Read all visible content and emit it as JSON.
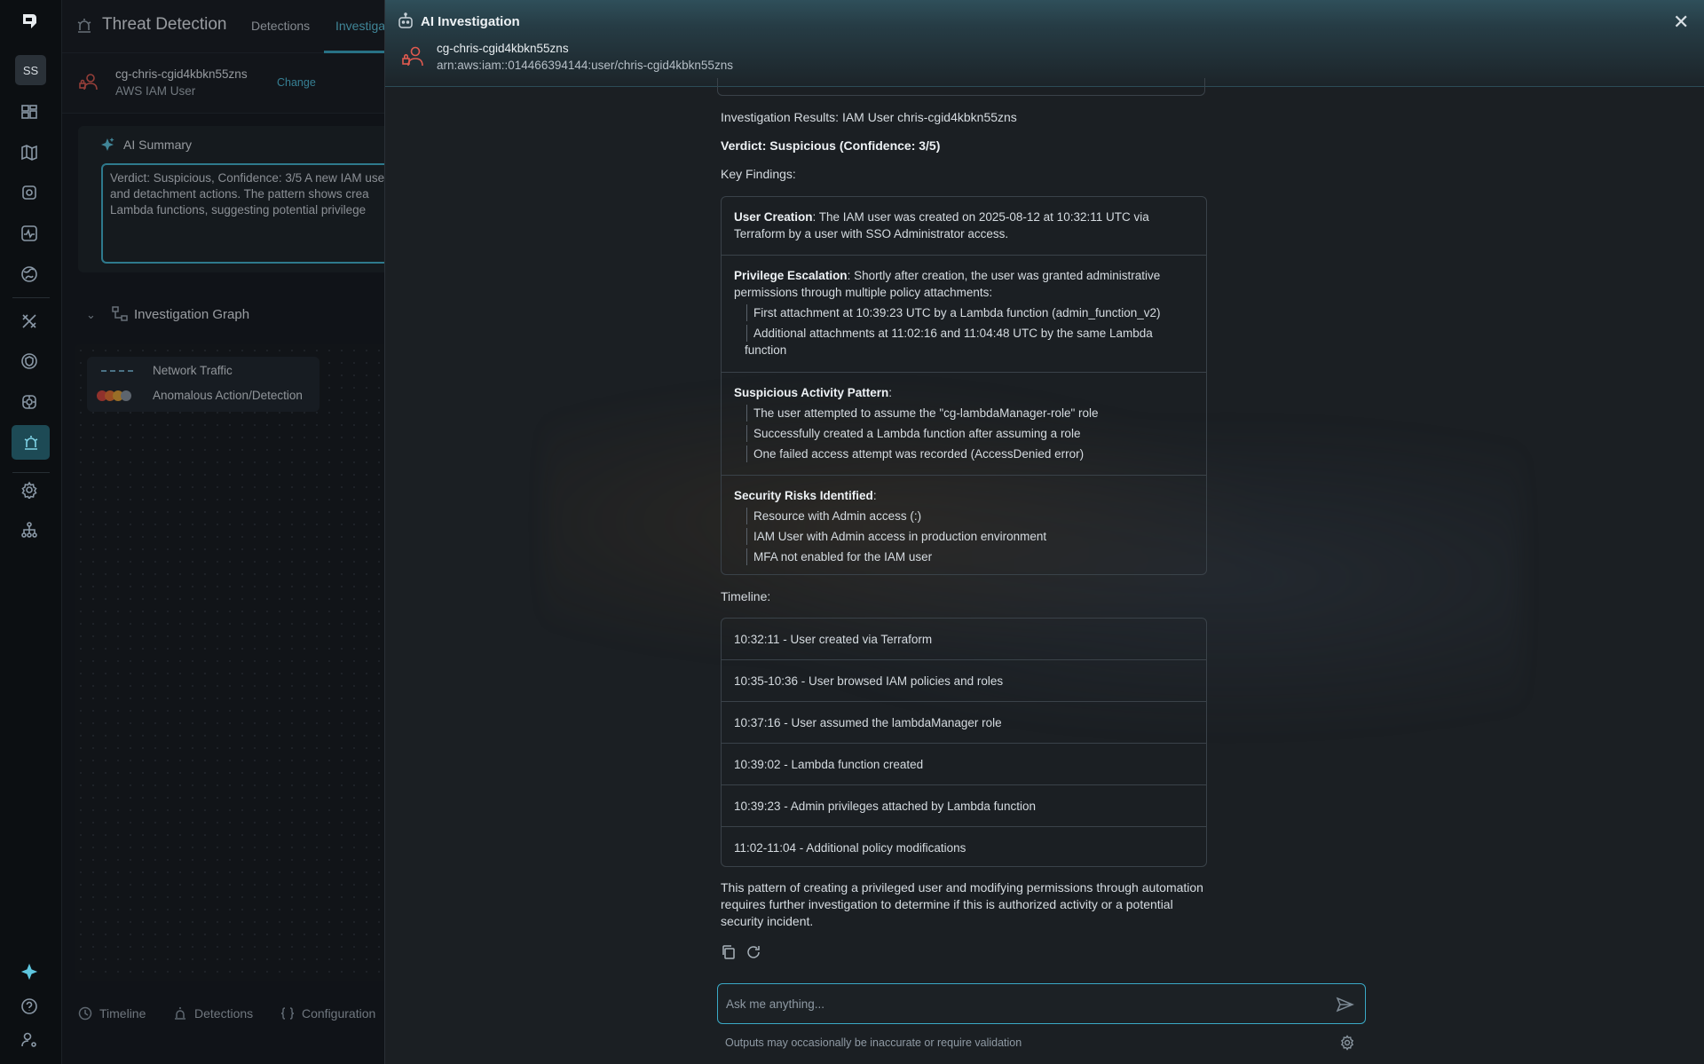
{
  "rail": {
    "avatar_initials": "SS"
  },
  "app": {
    "title": "Threat Detection",
    "tabs": [
      {
        "label": "Detections"
      },
      {
        "label": "Investiga"
      }
    ],
    "entity": {
      "name": "cg-chris-cgid4kbkn55zns",
      "type": "AWS IAM User",
      "change_label": "Change"
    },
    "ai_summary": {
      "title": "AI Summary",
      "text": "Verdict: Suspicious, Confidence: 3/5 A new IAM user and detachment actions. The pattern shows crea Lambda functions, suggesting potential privilege"
    },
    "graph": {
      "title": "Investigation Graph",
      "legend": [
        {
          "label": "Network Traffic"
        },
        {
          "label": "Anomalous Action/Detection"
        }
      ]
    },
    "bottom_tabs": [
      {
        "label": "Timeline"
      },
      {
        "label": "Detections"
      },
      {
        "label": "Configuration"
      }
    ]
  },
  "panel": {
    "title": "AI Investigation",
    "user_name": "cg-chris-cgid4kbkn55zns",
    "user_arn": "arn:aws:iam::014466394144:user/chris-cgid4kbkn55zns",
    "results_heading": "Investigation Results: IAM User chris-cgid4kbkn55zns",
    "verdict": "Verdict: Suspicious (Confidence: 3/5)",
    "key_findings_label": "Key Findings:",
    "findings": [
      {
        "title": "User Creation",
        "text": ": The IAM user was created on 2025-08-12 at 10:32:11 UTC via Terraform by a user with SSO Administrator access.",
        "items": []
      },
      {
        "title": "Privilege Escalation",
        "text": ": Shortly after creation, the user was granted administrative permissions through multiple policy attachments:",
        "items": [
          "First attachment at 10:39:23 UTC by a Lambda function (admin_function_v2)",
          "Additional attachments at 11:02:16 and 11:04:48 UTC by the same Lambda function"
        ]
      },
      {
        "title": "Suspicious Activity Pattern",
        "text": ":",
        "items": [
          "The user attempted to assume the \"cg-lambdaManager-role\" role",
          "Successfully created a Lambda function after assuming a role",
          "One failed access attempt was recorded (AccessDenied error)"
        ]
      },
      {
        "title": "Security Risks Identified",
        "text": ":",
        "items": [
          "Resource with Admin access (:)",
          "IAM User with Admin access in production environment",
          "MFA not enabled for the IAM user"
        ]
      }
    ],
    "timeline_label": "Timeline:",
    "timeline": [
      "10:32:11 - User created via Terraform",
      "10:35-10:36 - User browsed IAM policies and roles",
      "10:37:16 - User assumed the lambdaManager role",
      "10:39:02 - Lambda function created",
      "10:39:23 - Admin privileges attached by Lambda function",
      "11:02-11:04 - Additional policy modifications"
    ],
    "conclusion": "This pattern of creating a privileged user and modifying permissions through automation requires further investigation to determine if this is authorized activity or a potential security incident.",
    "ask_placeholder": "Ask me anything...",
    "disclaimer": "Outputs may occasionally be inaccurate or require validation"
  },
  "colors": {
    "accent": "#3aa9c6",
    "rail_active": "#1d4a55",
    "danger": "#e05a4f"
  }
}
